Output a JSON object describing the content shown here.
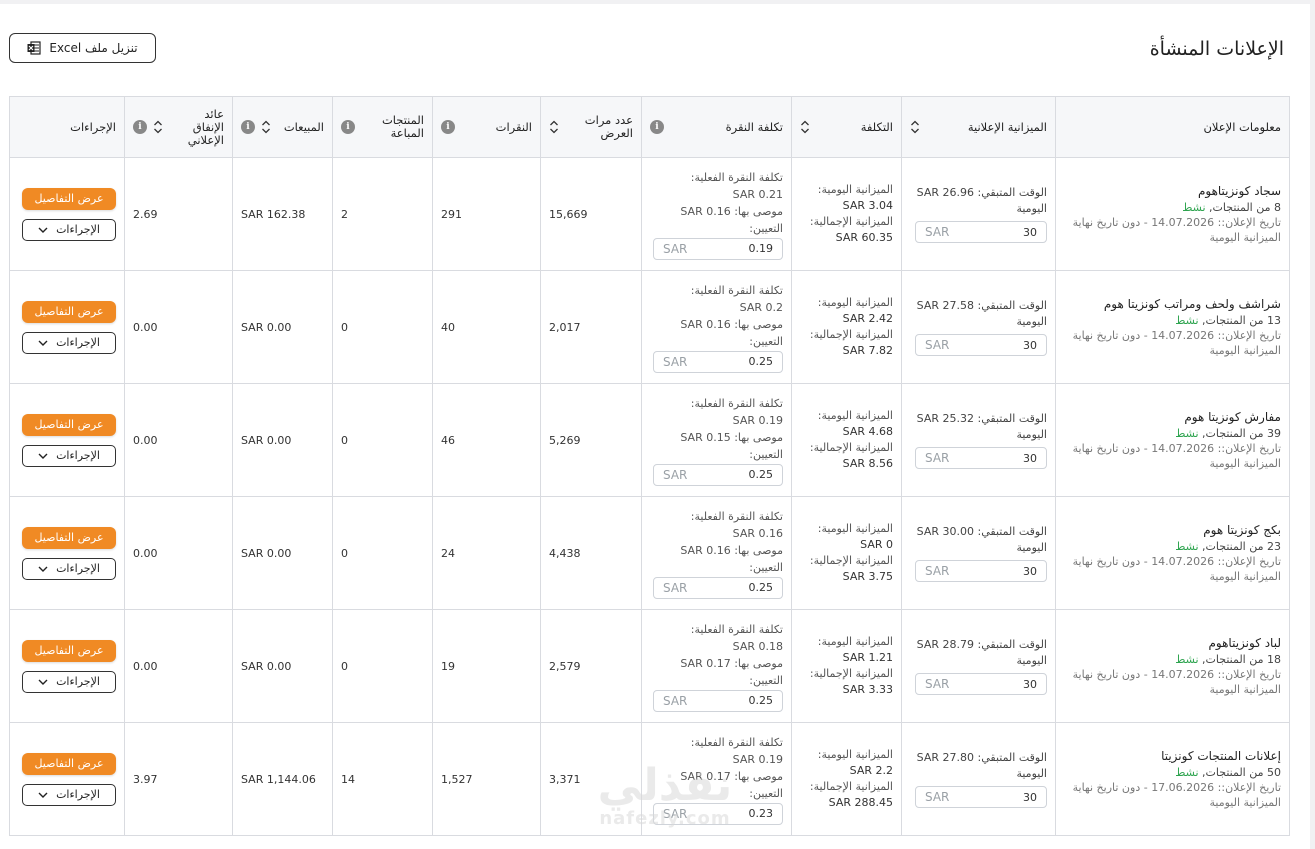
{
  "header": {
    "title": "الإعلانات المنشأة",
    "excel_label": "تنزيل ملف Excel"
  },
  "columns": {
    "info": "معلومات الإعلان",
    "budget": "الميزانية الإعلانية",
    "cost": "التكلفة",
    "cpc": "تكلفة النقرة",
    "impressions_l1": "عدد مرات",
    "impressions_l2": "العرض",
    "clicks": "النقرات",
    "sold_l1": "المنتجات",
    "sold_l2": "المباعة",
    "sales": "المبيعات",
    "roas_l1": "عائد",
    "roas_l2": "الإنفاق",
    "roas_l3": "الإعلاني",
    "actions": "الإجراءات"
  },
  "labels": {
    "active": "نشط",
    "remaining_prefix": "الوقت المتبقي:",
    "daily_suffix": "اليومية",
    "daily_budget": "الميزانية اليومية:",
    "total_budget": "الميزانية الإجمالية:",
    "actual_cpc": "تكلفة النقرة الفعلية:",
    "recommended": "موصى بها:",
    "assignment": "التعيين:",
    "currency": "SAR",
    "details_btn": "عرض التفاصيل",
    "actions_btn": "الإجراءات",
    "daily_budget_tail": "الميزانية اليومية"
  },
  "rows": [
    {
      "name": "سجاد كونزيتاهوم",
      "products": "8 من المنتجات,",
      "date": "تاريخ الإعلان:: 14.07.2026 - دون تاريخ نهاية",
      "remaining": "SAR 26.96",
      "budget_input": "30",
      "daily": "SAR 3.04",
      "total": "SAR 60.35",
      "actual_cpc": "SAR 0.21",
      "recommended": "SAR 0.16",
      "cpc_input": "0.19",
      "impressions": "15,669",
      "clicks": "291",
      "sold": "2",
      "sales": "SAR 162.38",
      "roas": "2.69"
    },
    {
      "name": "شراشف ولحف ومراتب كونزيتا هوم",
      "products": "13 من المنتجات,",
      "date": "تاريخ الإعلان:: 14.07.2026 - دون تاريخ نهاية",
      "remaining": "SAR 27.58",
      "budget_input": "30",
      "daily": "SAR 2.42",
      "total": "SAR 7.82",
      "actual_cpc": "SAR 0.2",
      "recommended": "SAR 0.16",
      "cpc_input": "0.25",
      "impressions": "2,017",
      "clicks": "40",
      "sold": "0",
      "sales": "SAR 0.00",
      "roas": "0.00"
    },
    {
      "name": "مفارش كونزيتا هوم",
      "products": "39 من المنتجات,",
      "date": "تاريخ الإعلان:: 14.07.2026 - دون تاريخ نهاية",
      "remaining": "SAR 25.32",
      "budget_input": "30",
      "daily": "SAR 4.68",
      "total": "SAR 8.56",
      "actual_cpc": "SAR 0.19",
      "recommended": "SAR 0.15",
      "cpc_input": "0.25",
      "impressions": "5,269",
      "clicks": "46",
      "sold": "0",
      "sales": "SAR 0.00",
      "roas": "0.00"
    },
    {
      "name": "بكج كونزيتا هوم",
      "products": "23 من المنتجات,",
      "date": "تاريخ الإعلان:: 14.07.2026 - دون تاريخ نهاية",
      "remaining": "SAR 30.00",
      "budget_input": "30",
      "daily": "SAR 0",
      "total": "SAR 3.75",
      "actual_cpc": "SAR 0.16",
      "recommended": "SAR 0.16",
      "cpc_input": "0.25",
      "impressions": "4,438",
      "clicks": "24",
      "sold": "0",
      "sales": "SAR 0.00",
      "roas": "0.00"
    },
    {
      "name": "لباد كونزيتاهوم",
      "products": "18 من المنتجات,",
      "date": "تاريخ الإعلان:: 14.07.2026 - دون تاريخ نهاية",
      "remaining": "SAR 28.79",
      "budget_input": "30",
      "daily": "SAR 1.21",
      "total": "SAR 3.33",
      "actual_cpc": "SAR 0.18",
      "recommended": "SAR 0.17",
      "cpc_input": "0.25",
      "impressions": "2,579",
      "clicks": "19",
      "sold": "0",
      "sales": "SAR 0.00",
      "roas": "0.00"
    },
    {
      "name": "إعلانات المنتجات كونزيتا",
      "products": "50 من المنتجات,",
      "date": "تاريخ الإعلان:: 17.06.2026 - دون تاريخ نهاية",
      "remaining": "SAR 27.80",
      "budget_input": "30",
      "daily": "SAR 2.2",
      "total": "SAR 288.45",
      "actual_cpc": "SAR 0.19",
      "recommended": "SAR 0.17",
      "cpc_input": "0.23",
      "impressions": "3,371",
      "clicks": "1,527",
      "sold": "14",
      "sales": "SAR 1,144.06",
      "roas": "3.97"
    }
  ],
  "watermark": {
    "line1": "نفذلي",
    "line2": "nafezly.com"
  }
}
